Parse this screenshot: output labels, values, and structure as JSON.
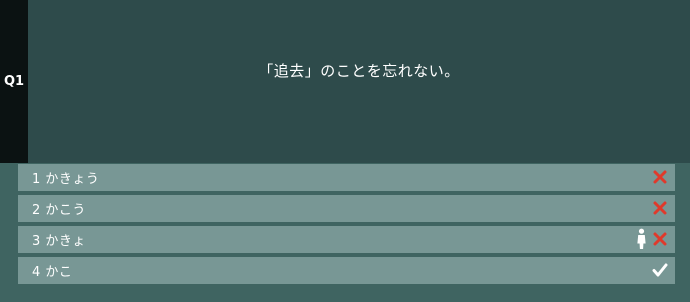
{
  "question": {
    "number": "Q1",
    "text": "「追去」のことを忘れない。"
  },
  "answers": [
    {
      "label": "1 かきょう",
      "mark": "cross-icon",
      "player_marker": false
    },
    {
      "label": "2 かこう",
      "mark": "cross-icon",
      "player_marker": false
    },
    {
      "label": "3 かきょ",
      "mark": "cross-icon",
      "player_marker": true
    },
    {
      "label": "4 かこ",
      "mark": "check-icon",
      "player_marker": false
    }
  ],
  "colors": {
    "background": "#3f6461",
    "question_panel": "#2e4b4b",
    "number_strip": "#0b1212",
    "answer_row": "#789795",
    "wrong": "#e0392b",
    "correct": "#ffffff"
  }
}
